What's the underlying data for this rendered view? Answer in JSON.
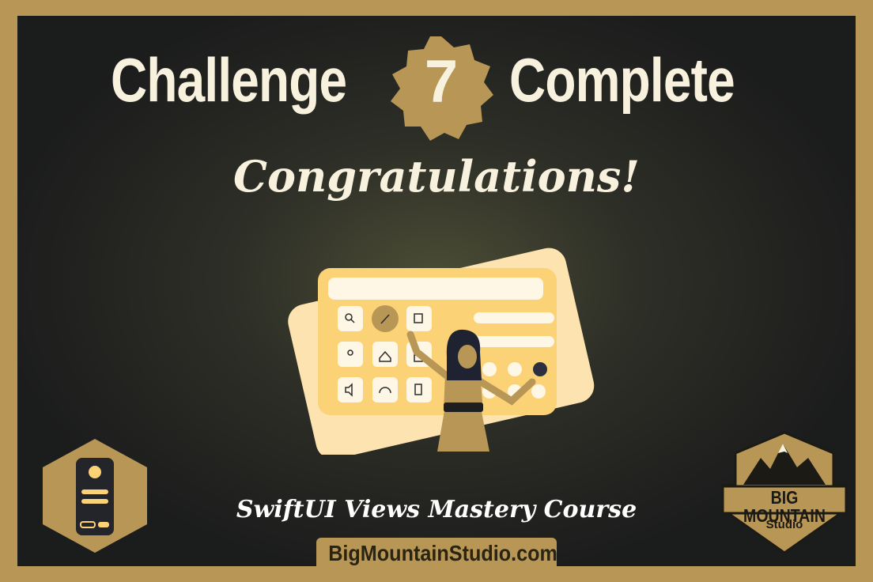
{
  "header": {
    "title_left": "Challenge",
    "badge_number": "7",
    "title_right": "Complete"
  },
  "subtitle": "Congratulations!",
  "course": {
    "name": "SwiftUI Views Mastery Course",
    "url": "BigMountainStudio.com"
  },
  "brand_logo": {
    "line1": "BIG MOUNTAIN",
    "line2": "Studio"
  },
  "icons": [
    "search-icon",
    "pencil-icon",
    "note-icon",
    "location-pin-icon",
    "home-icon",
    "lock-icon",
    "speaker-icon",
    "headphones-icon",
    "trash-icon"
  ],
  "colors": {
    "gold": "#b89656",
    "cream": "#f8f1de",
    "card_yellow": "#fcd277",
    "card_back": "#fde3b0",
    "dark": "#1b1c1c"
  }
}
